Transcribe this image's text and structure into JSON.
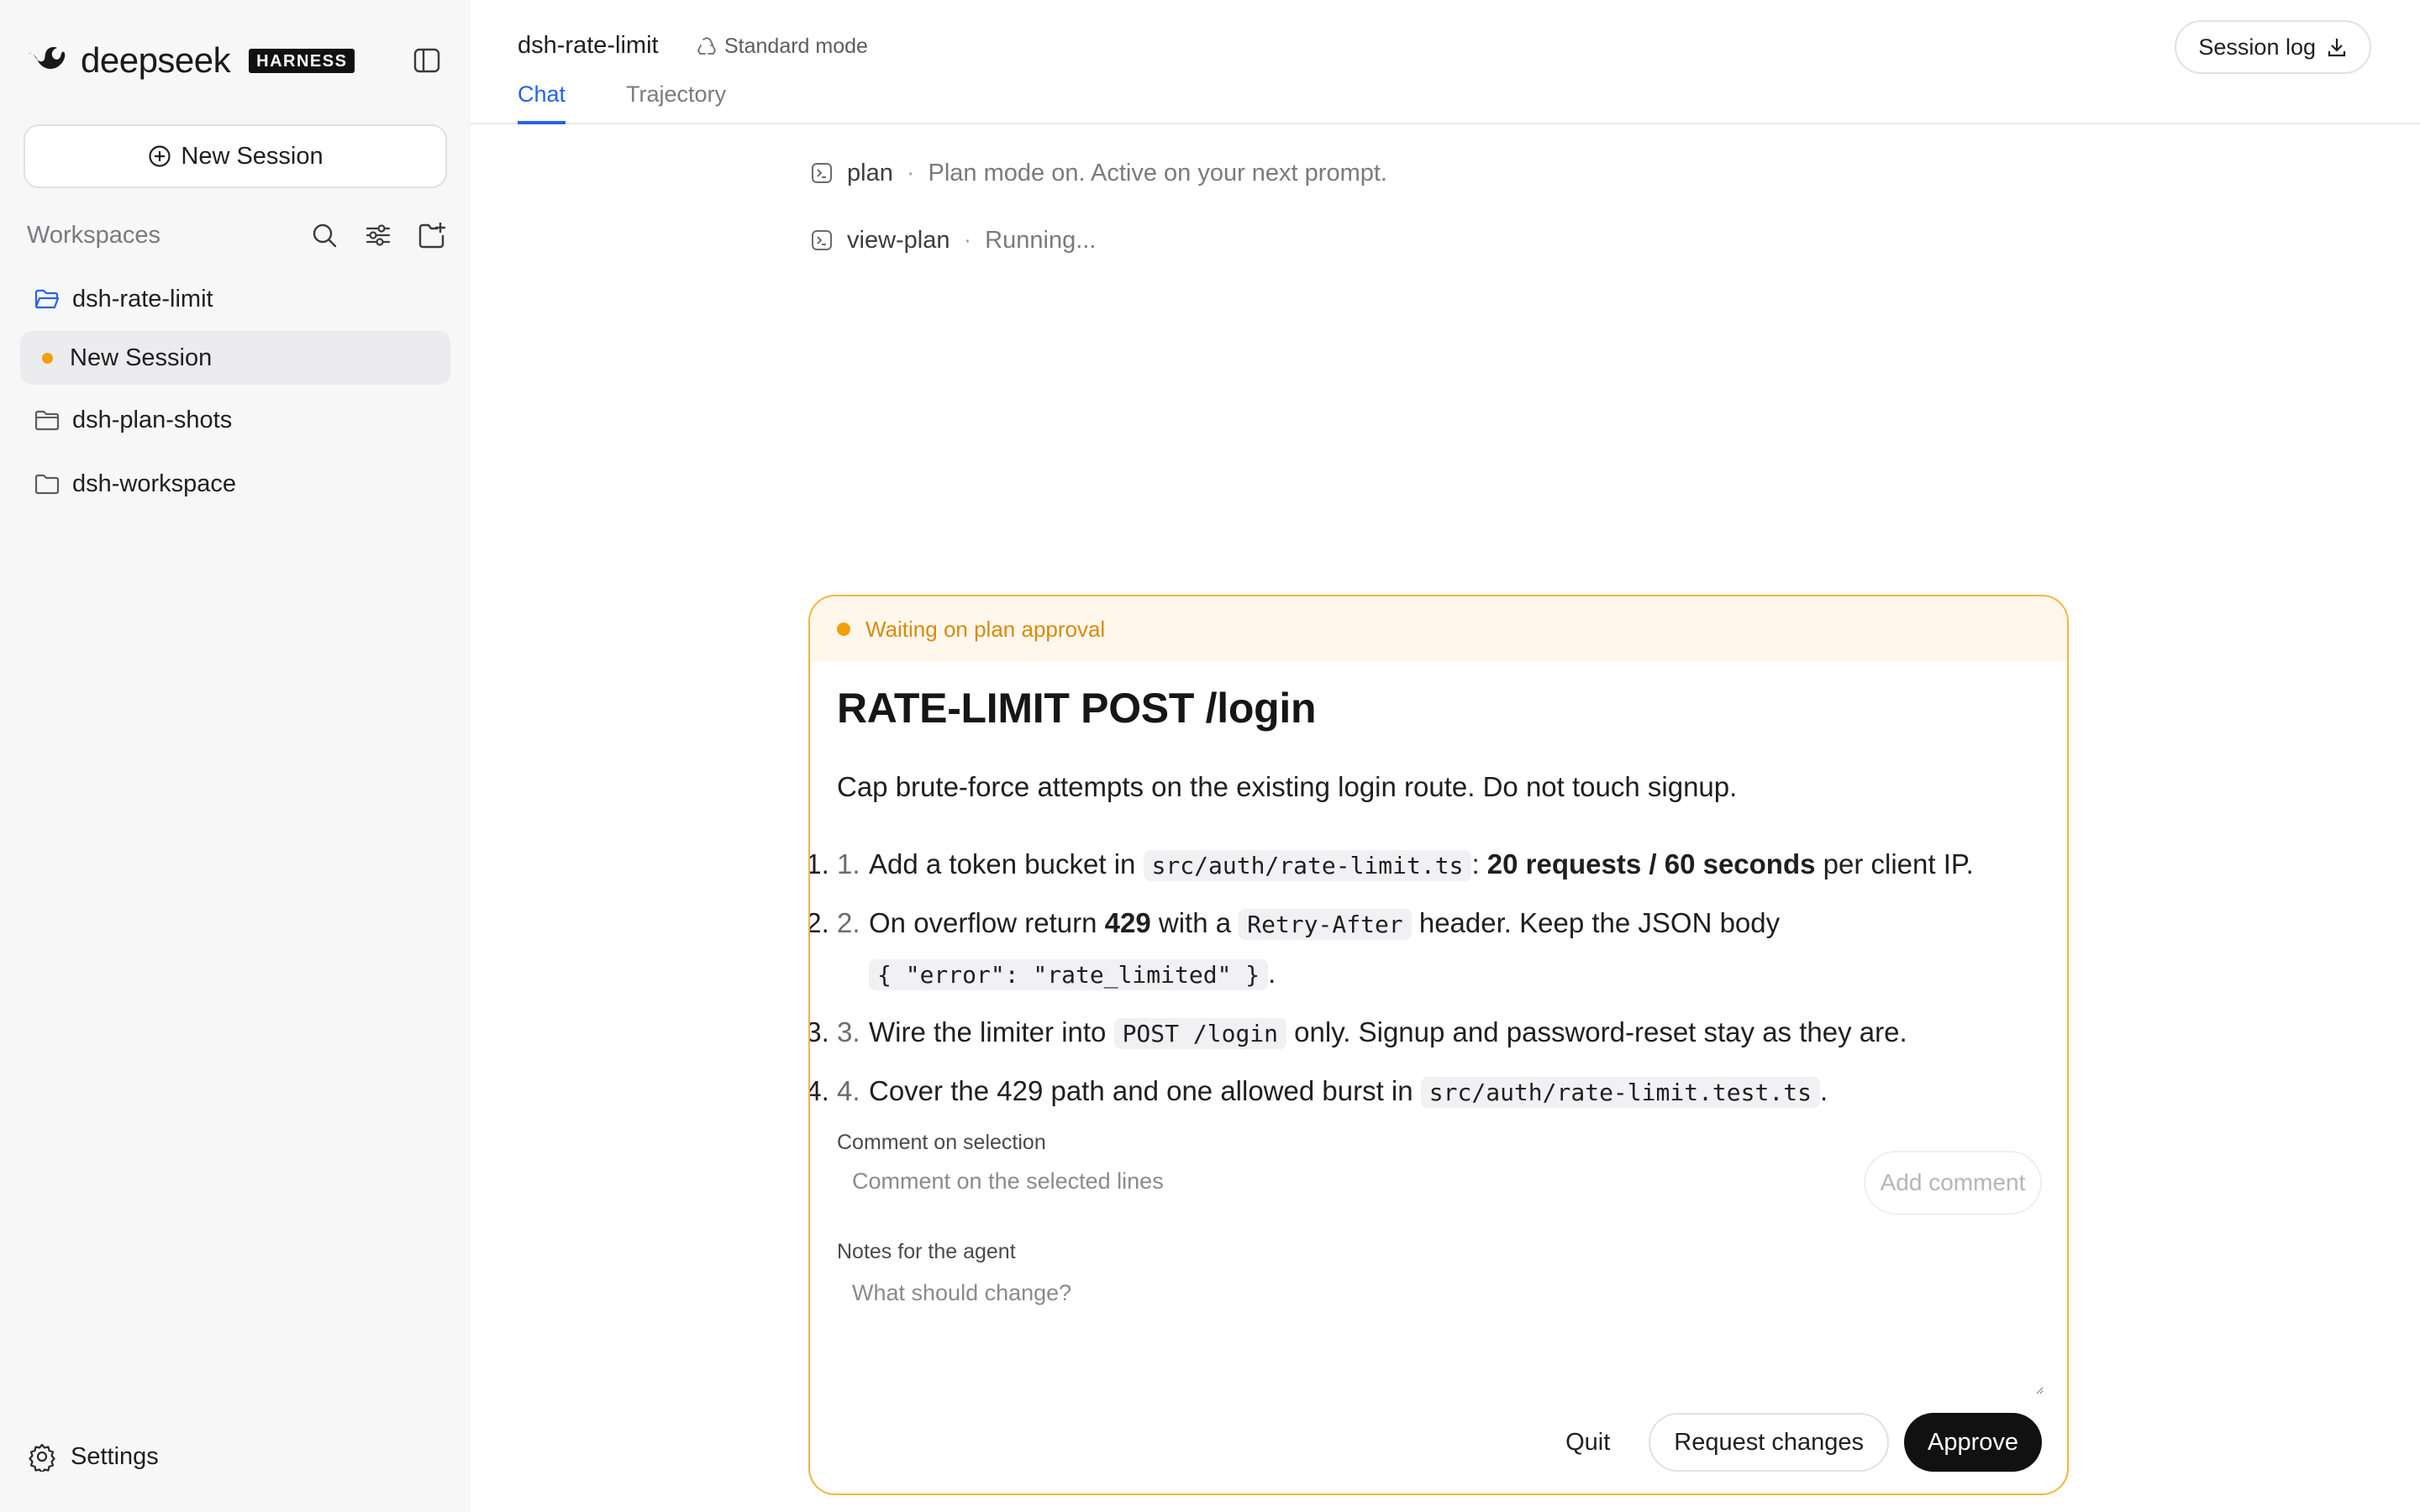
{
  "sidebar": {
    "brand_name": "deepseek",
    "brand_badge": "HARNESS",
    "new_session_label": "New Session",
    "workspaces_title": "Workspaces",
    "items": [
      {
        "label": "dsh-rate-limit",
        "type": "folder-open",
        "icon": "folder-open-icon"
      },
      {
        "label": "New Session",
        "type": "session",
        "active": true,
        "status_color": "#f59e0b"
      },
      {
        "label": "dsh-plan-shots",
        "type": "folder",
        "icon": "folder-icon"
      },
      {
        "label": "dsh-workspace",
        "type": "folder",
        "icon": "folder-icon"
      }
    ],
    "settings_label": "Settings"
  },
  "header": {
    "workspace_name": "dsh-rate-limit",
    "mode_label": "Standard mode",
    "tabs": [
      {
        "label": "Chat",
        "active": true
      },
      {
        "label": "Trajectory",
        "active": false
      }
    ],
    "session_log_label": "Session log"
  },
  "commands": [
    {
      "name": "plan",
      "message": "Plan mode on. Active on your next prompt."
    },
    {
      "name": "view-plan",
      "message": "Running..."
    }
  ],
  "plan": {
    "status": "Waiting on plan approval",
    "title": "RATE-LIMIT POST /login",
    "summary": "Cap brute-force attempts on the existing login route. Do not touch signup.",
    "steps": [
      {
        "num": "1.",
        "t1": "Add a token bucket in ",
        "code1": "src/auth/rate-limit.ts",
        "t2": ": ",
        "bold1": "20 requests / 60 seconds",
        "t3": " per client IP."
      },
      {
        "num": "2.",
        "t1": "On overflow return ",
        "bold1": "429",
        "t2": " with a ",
        "code1": "Retry-After",
        "t3": " header. Keep the JSON body",
        "code2": "{ \"error\": \"rate_limited\" }",
        "t4": "."
      },
      {
        "num": "3.",
        "t1": "Wire the limiter into ",
        "code1": "POST /login",
        "t2": " only. Signup and password-reset stay as they are."
      },
      {
        "num": "4.",
        "t1": "Cover the 429 path and one allowed burst in ",
        "code1": "src/auth/rate-limit.test.ts",
        "t2": "."
      }
    ],
    "comment_label": "Comment on selection",
    "comment_placeholder": "Comment on the selected lines",
    "add_comment_label": "Add comment",
    "notes_label": "Notes for the agent",
    "notes_placeholder": "What should change?",
    "buttons": {
      "quit": "Quit",
      "request_changes": "Request changes",
      "approve": "Approve"
    }
  },
  "colors": {
    "accent": "#2563eb",
    "warning": "#f59e0b",
    "banner_bg": "#fff7ec",
    "approve_bg": "#111111"
  }
}
